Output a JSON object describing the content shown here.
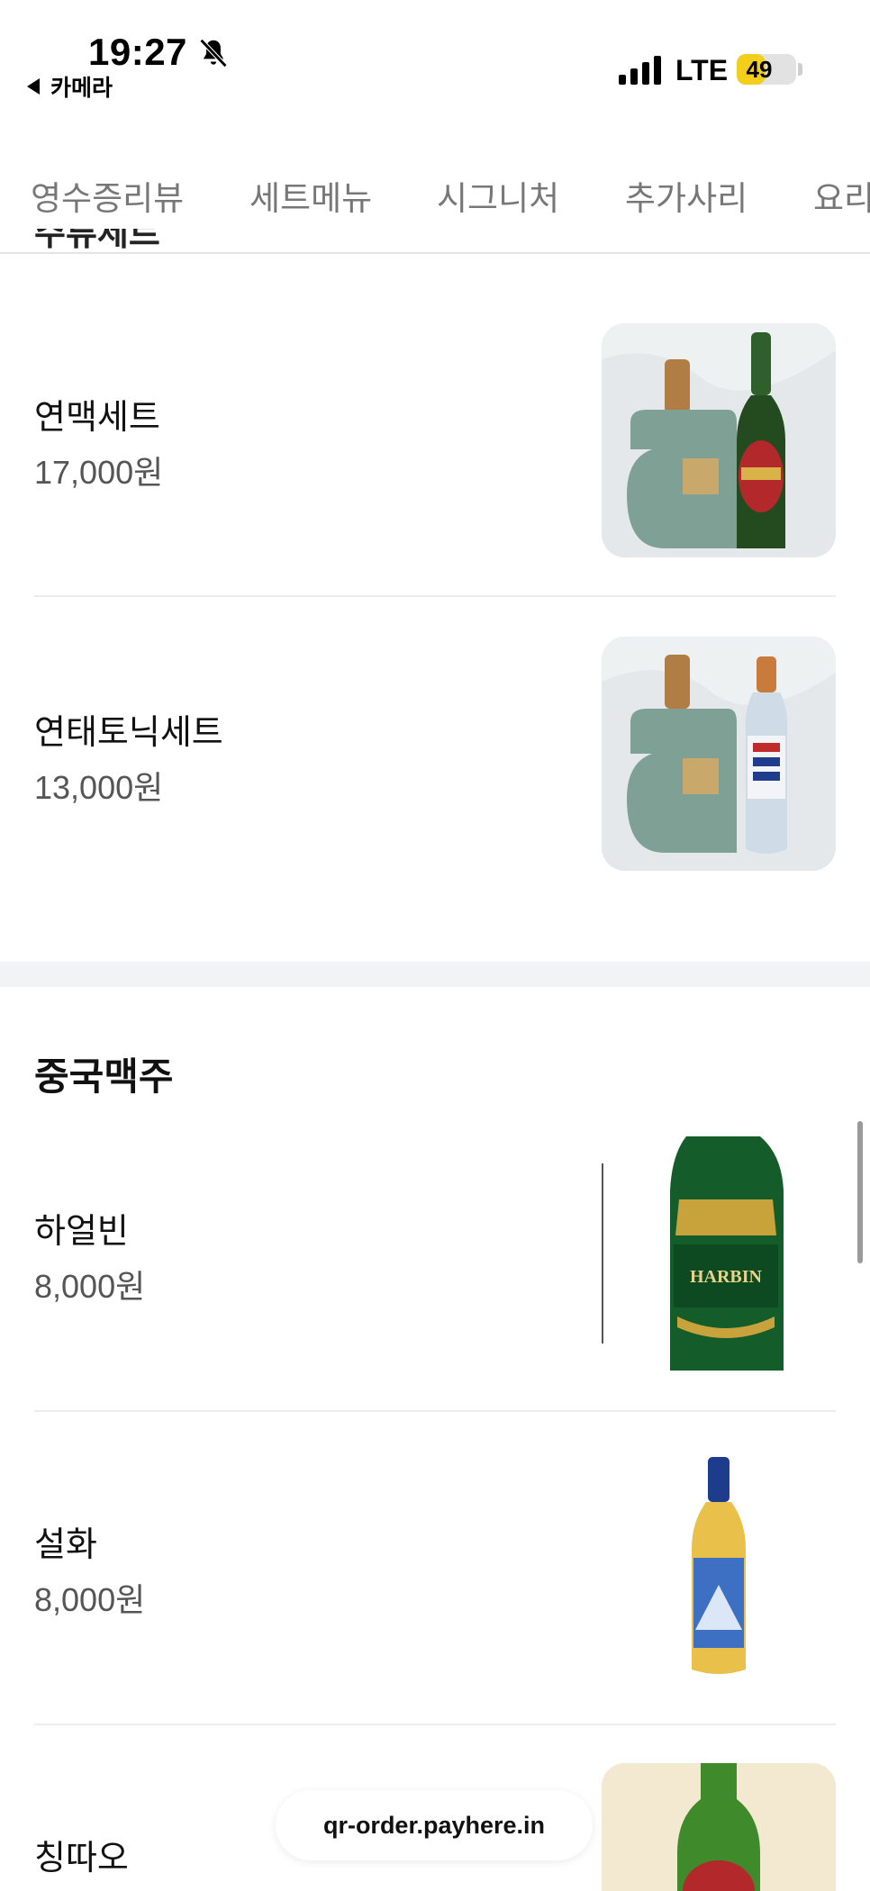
{
  "status_bar": {
    "time": "19:27",
    "back_label": "카메라",
    "network": "LTE",
    "battery_percent": "49",
    "battery_level": 0.49
  },
  "tabs": [
    {
      "label": "영수증리뷰"
    },
    {
      "label": "세트메뉴"
    },
    {
      "label": "시그니처"
    },
    {
      "label": "추가사리"
    },
    {
      "label": "요리"
    }
  ],
  "sections": {
    "partial_title": "주류세트",
    "set_items": [
      {
        "name": "연맥세트",
        "price": "17,000원",
        "image": "baijiu-and-tsingtao-beer-photo"
      },
      {
        "name": "연태토닉세트",
        "price": "13,000원",
        "image": "baijiu-and-tonic-water-photo"
      }
    ],
    "beer_title": "중국맥주",
    "beer_items": [
      {
        "name": "하얼빈",
        "price": "8,000원",
        "image": "harbin-beer-bottle-photo",
        "bottle_label": "HARBIN"
      },
      {
        "name": "설화",
        "price": "8,000원",
        "image": "snow-beer-bottle-photo"
      },
      {
        "name": "칭따오",
        "price": "",
        "image": "tsingtao-beer-bottle-photo"
      }
    ]
  },
  "footer": {
    "url": "qr-order.payhere.in"
  },
  "colors": {
    "tab_text": "#777777",
    "price_text": "#555555",
    "battery_fill": "#f3ce1a",
    "section_gap": "#f2f3f5"
  }
}
